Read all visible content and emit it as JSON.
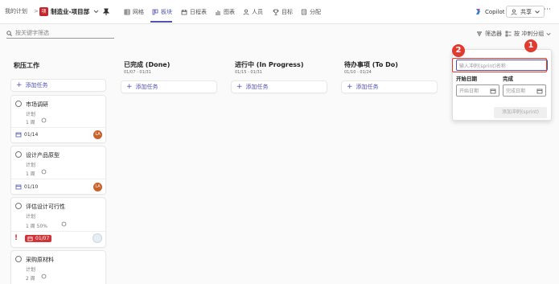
{
  "header": {
    "breadcrumb_root": "我的计划",
    "breadcrumb_sep": ">",
    "project_logo": "项",
    "project_name": "制造业-项目部",
    "tabs": [
      "网格",
      "板块",
      "日程表",
      "图表",
      "人员",
      "目标",
      "分配"
    ],
    "active_tab_index": 1,
    "copilot_label": "Copilot",
    "share_label": "共享"
  },
  "toolbar": {
    "search_placeholder": "按关键字筛选",
    "filter_label": "筛选器",
    "group_label": "按 冲刺分组"
  },
  "board": {
    "columns": [
      {
        "title": "积压工作",
        "dates": "",
        "add_label": "添加任务"
      },
      {
        "title": "已完成 (Done)",
        "dates": "01/07 - 01/31",
        "add_label": "添加任务"
      },
      {
        "title": "进行中 (In Progress)",
        "dates": "01/15 - 01/31",
        "add_label": "添加任务"
      },
      {
        "title": "待办事项 (To Do)",
        "dates": "01/10 - 01/24",
        "add_label": "添加任务"
      }
    ],
    "cards": [
      {
        "title": "市场调研",
        "status": "计划",
        "meta": "1 周",
        "date": "01/14",
        "avatar": "LA",
        "overdue": false
      },
      {
        "title": "设计产品原型",
        "status": "计划",
        "meta": "1 周",
        "date": "01/10",
        "avatar": "LA",
        "overdue": false
      },
      {
        "title": "评估设计可行性",
        "status": "计划",
        "meta": "1 周   50%",
        "date": "01/07",
        "avatar": "",
        "overdue": true
      },
      {
        "title": "采购原材料",
        "status": "计划",
        "meta": "2 周",
        "date": "",
        "avatar": "",
        "overdue": false
      }
    ]
  },
  "sprint_panel": {
    "name_placeholder": "输入冲刺(sprint)名称",
    "start_label": "开始日期",
    "end_label": "完成",
    "start_placeholder": "开始日期",
    "end_placeholder": "完成日期",
    "submit_label": "添加冲刺(sprint)"
  },
  "callouts": {
    "one": "1",
    "two": "2"
  },
  "colors": {
    "accent": "#4f52b2",
    "callout": "#e03b2e",
    "overdue": "#d13438",
    "avatar": "#c8612a"
  }
}
